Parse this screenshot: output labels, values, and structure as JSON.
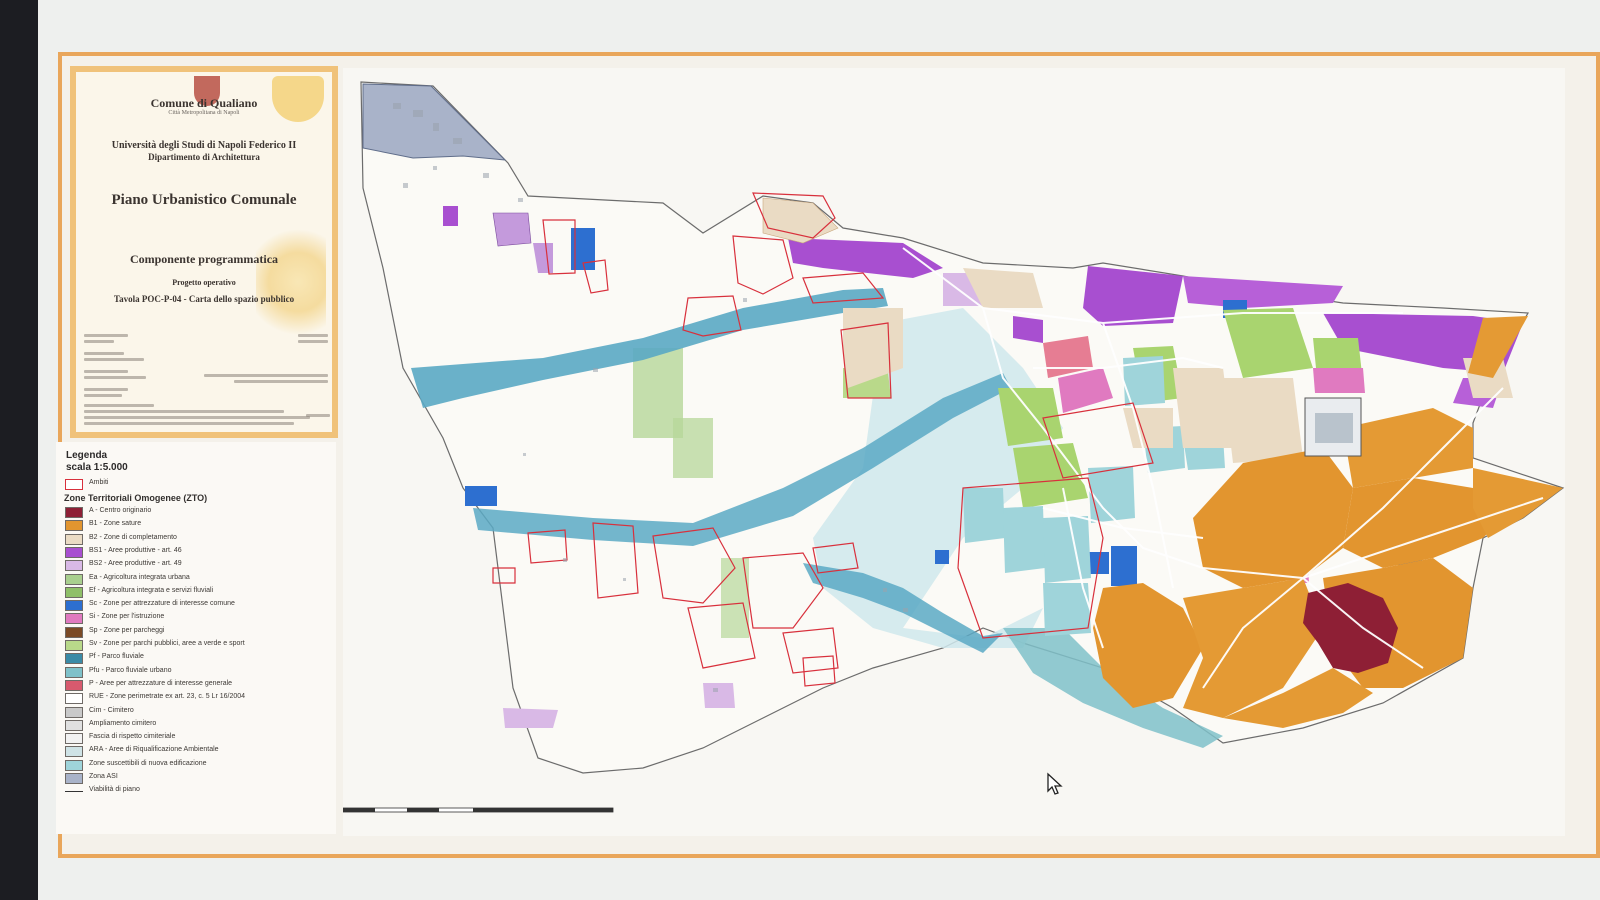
{
  "titleblock": {
    "comune": "Comune di Qualiano",
    "city": "Città Metropolitana di Napoli",
    "university": "Università degli Studi di Napoli Federico II",
    "department": "Dipartimento di Architettura",
    "plan": "Piano Urbanistico Comunale",
    "component": "Componente programmatica",
    "project": "Progetto operativo",
    "tavola": "Tavola POC-P-04 - Carta dello spazio pubblico"
  },
  "legend": {
    "title": "Legenda",
    "scale": "scala 1:5.000",
    "ambiti": "Ambiti",
    "zto_heading": "Zone Territoriali Omogenee (ZTO)",
    "items": [
      {
        "label": "A - Centro originario",
        "color": "#8e1f35"
      },
      {
        "label": "B1 - Zone sature",
        "color": "#e2952f"
      },
      {
        "label": "B2 - Zone di completamento",
        "color": "#eadbc4"
      },
      {
        "label": "BS1 - Aree produttive - art. 46",
        "color": "#a84fd0"
      },
      {
        "label": "BS2 - Aree produttive - art. 49",
        "color": "#d9b9e6"
      },
      {
        "label": "Ea - Agricoltura integrata urbana",
        "color": "#a9cf8e"
      },
      {
        "label": "Ef - Agricoltura integrata e servizi fluviali",
        "color": "#8fbf68"
      },
      {
        "label": "Sc - Zone per attrezzature di interesse comune",
        "color": "#2d6fd0"
      },
      {
        "label": "Si - Zone per l'istruzione",
        "color": "#e07ac0"
      },
      {
        "label": "Sp - Zone per parcheggi",
        "color": "#7b4a25"
      },
      {
        "label": "Sv - Zone per parchi pubblici, aree a verde e sport",
        "color": "#b9d98a"
      },
      {
        "label": "Pf - Parco fluviale",
        "color": "#3a8aa6"
      },
      {
        "label": "Pfu - Parco fluviale urbano",
        "color": "#7fc1c9"
      },
      {
        "label": "P - Aree per attrezzature di interesse generale",
        "color": "#d85a6e"
      },
      {
        "label": "RUE - Zone perimetrate ex art. 23, c. 5 Lr 16/2004",
        "color": "#ffffff"
      },
      {
        "label": "Cim - Cimitero",
        "color": "#c9c9c9"
      },
      {
        "label": "Ampliamento cimitero",
        "color": "#e0e0e0"
      },
      {
        "label": "Fascia di rispetto cimiteriale",
        "color": "#f2f2f2"
      },
      {
        "label": "ARA - Aree di Riqualificazione Ambientale",
        "color": "#cfe3e6"
      },
      {
        "label": "Zone suscettibili di nuova edificazione",
        "color": "#9fd4da"
      },
      {
        "label": "Zona ASI",
        "color": "#a9b3c9"
      },
      {
        "label": "Viabilità di piano",
        "color": "none"
      }
    ]
  },
  "colors": {
    "sheet_border": "#e9a65a",
    "river": "#5aa9c4",
    "rue_outline": "#d8303c"
  }
}
